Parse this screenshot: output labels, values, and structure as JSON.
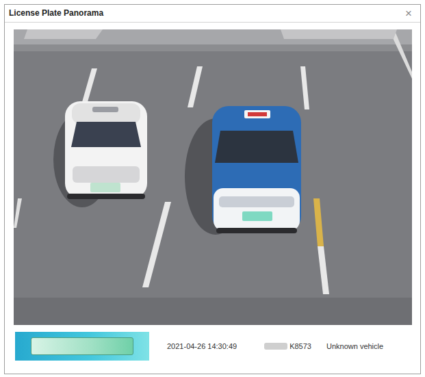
{
  "window": {
    "title": "License Plate Panorama",
    "close": "×"
  },
  "record": {
    "time": "2021-04-26 14:30:49",
    "plate": "K8573",
    "vehicle_type": "Unknown vehicle"
  }
}
